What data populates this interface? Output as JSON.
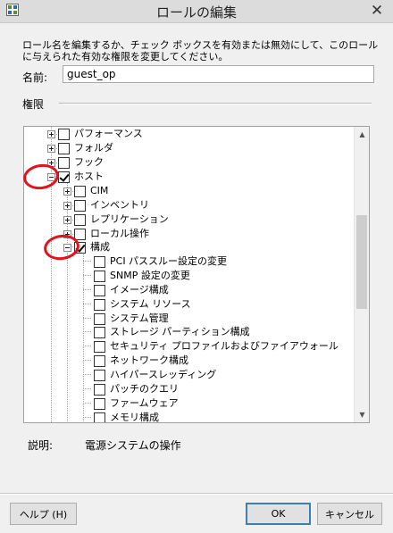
{
  "window": {
    "title": "ロールの編集",
    "close_glyph": "✕"
  },
  "description": "ロール名を編集するか、チェック ボックスを有効または無効にして、このロールに与えられた有効な権限を変更してください。",
  "name_field": {
    "label": "名前:",
    "value": "guest_op"
  },
  "permissions": {
    "label": "権限",
    "items": [
      {
        "label": "パフォーマンス",
        "expander": "plus",
        "checked": false
      },
      {
        "label": "フォルダ",
        "expander": "plus",
        "checked": false
      },
      {
        "label": "フック",
        "expander": "plus",
        "checked": false
      },
      {
        "label": "ホスト",
        "expander": "minus",
        "checked": true
      },
      {
        "label": "CIM",
        "expander": "plus",
        "checked": false
      },
      {
        "label": "インベントリ",
        "expander": "plus",
        "checked": false
      },
      {
        "label": "レプリケーション",
        "expander": "plus",
        "checked": false
      },
      {
        "label": "ローカル操作",
        "expander": "plus",
        "checked": false
      },
      {
        "label": "構成",
        "expander": "minus",
        "checked": true
      },
      {
        "label": "PCI パススルー設定の変更",
        "expander": "none",
        "checked": false
      },
      {
        "label": "SNMP 設定の変更",
        "expander": "none",
        "checked": false
      },
      {
        "label": "イメージ構成",
        "expander": "none",
        "checked": false
      },
      {
        "label": "システム リソース",
        "expander": "none",
        "checked": false
      },
      {
        "label": "システム管理",
        "expander": "none",
        "checked": false
      },
      {
        "label": "ストレージ パーティション構成",
        "expander": "none",
        "checked": false
      },
      {
        "label": "セキュリティ プロファイルおよびファイアウォール",
        "expander": "none",
        "checked": false
      },
      {
        "label": "ネットワーク構成",
        "expander": "none",
        "checked": false
      },
      {
        "label": "ハイパースレッディング",
        "expander": "none",
        "checked": false
      },
      {
        "label": "パッチのクエリ",
        "expander": "none",
        "checked": false
      },
      {
        "label": "ファームウェア",
        "expander": "none",
        "checked": false
      },
      {
        "label": "メモリ構成",
        "expander": "none",
        "checked": false
      }
    ]
  },
  "explanation": {
    "label": "説明:",
    "value": "電源システムの操作"
  },
  "buttons": {
    "help": "ヘルプ (H)",
    "ok": "OK",
    "cancel": "キャンセル"
  },
  "icons": {
    "app": "vsphere-icon",
    "scroll_up": "▲",
    "scroll_down": "▼"
  },
  "colors": {
    "annotation": "#e8101a",
    "default_button_border": "#3c7fb1"
  }
}
